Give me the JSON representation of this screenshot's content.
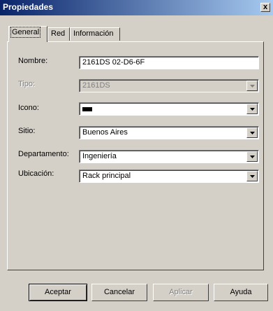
{
  "window": {
    "title": "Propiedades",
    "close_label": "x"
  },
  "tabs": [
    {
      "label": "General"
    },
    {
      "label": "Red"
    },
    {
      "label": "Información"
    }
  ],
  "fields": {
    "nombre": {
      "label": "Nombre:",
      "value": "2161DS 02-D6-6F"
    },
    "tipo": {
      "label": "Tipo:",
      "value": "2161DS"
    },
    "icono": {
      "label": "Icono:",
      "icon": "hardware-device-icon"
    },
    "sitio": {
      "label": "Sitio:",
      "value": "Buenos Aires"
    },
    "departamento": {
      "label": "Departamento:",
      "value": "Ingeniería"
    },
    "ubicacion": {
      "label": "Ubicación:",
      "value": "Rack principal"
    }
  },
  "buttons": {
    "aceptar": "Aceptar",
    "cancelar": "Cancelar",
    "aplicar": "Aplicar",
    "ayuda": "Ayuda"
  }
}
